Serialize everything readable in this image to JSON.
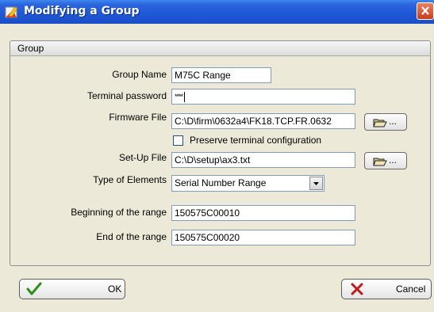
{
  "window": {
    "title": "Modifying a Group"
  },
  "group": {
    "header": "Group"
  },
  "form": {
    "group_name_label": "Group Name",
    "group_name_value": "M75C Range",
    "terminal_password_label": "Terminal password",
    "terminal_password_value": "****",
    "firmware_file_label": "Firmware File",
    "firmware_file_value": "C:\\D\\firm\\0632a4\\FK18.TCP.FR.0632",
    "preserve_label": "Preserve terminal configuration",
    "preserve_checked": false,
    "setup_file_label": "Set-Up File",
    "setup_file_value": "C:\\D\\setup\\ax3.txt",
    "type_label": "Type of Elements",
    "type_value": "Serial Number Range",
    "begin_label": "Beginning of the range",
    "begin_value": "150575C00010",
    "end_label": "End of the range",
    "end_value": "150575C00020",
    "browse_dots": "..."
  },
  "buttons": {
    "ok_label": "OK",
    "cancel_label": "Cancel"
  },
  "colors": {
    "titlebar": "#1f57d6",
    "close": "#d8552f",
    "dialog_bg": "#ece9d8",
    "ok_check": "#2f8f1e",
    "cancel_x": "#c01818"
  }
}
